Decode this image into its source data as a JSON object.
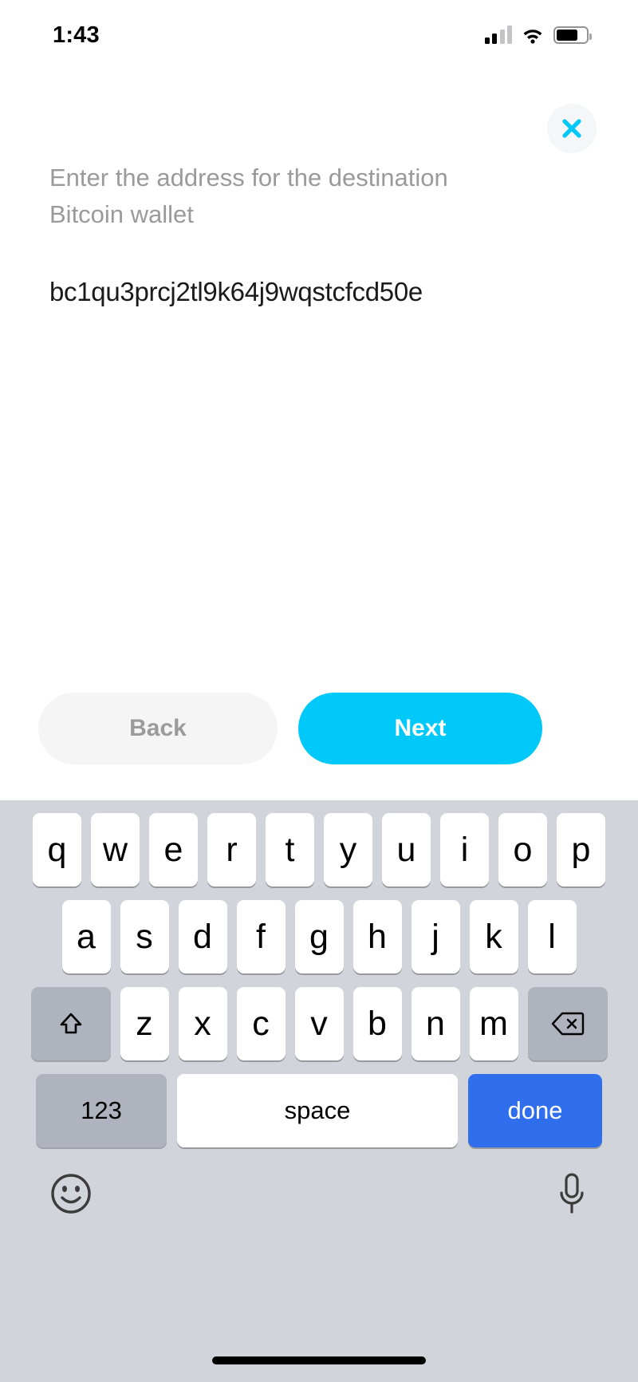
{
  "status_bar": {
    "time": "1:43",
    "signal_icon": "cellular-signal-icon",
    "wifi_icon": "wifi-icon",
    "battery_icon": "battery-icon"
  },
  "header": {
    "close_icon": "close-icon"
  },
  "form": {
    "prompt": "Enter the address for the destination Bitcoin wallet",
    "address_value": "bc1qu3prcj2tl9k64j9wqstcfcd50e",
    "address_placeholder": ""
  },
  "actions": {
    "back_label": "Back",
    "next_label": "Next"
  },
  "keyboard": {
    "row1": [
      "q",
      "w",
      "e",
      "r",
      "t",
      "y",
      "u",
      "i",
      "o",
      "p"
    ],
    "row2": [
      "a",
      "s",
      "d",
      "f",
      "g",
      "h",
      "j",
      "k",
      "l"
    ],
    "row3": [
      "z",
      "x",
      "c",
      "v",
      "b",
      "n",
      "m"
    ],
    "shift_icon": "shift-arrow-icon",
    "backspace_icon": "backspace-icon",
    "numeric_label": "123",
    "space_label": "space",
    "done_label": "done",
    "emoji_icon": "emoji-smiley-icon",
    "mic_icon": "microphone-icon"
  },
  "colors": {
    "accent": "#00c8f8",
    "done_key": "#2f6fed",
    "keyboard_bg": "#d1d5db",
    "prompt_text": "#9a9a9a"
  }
}
